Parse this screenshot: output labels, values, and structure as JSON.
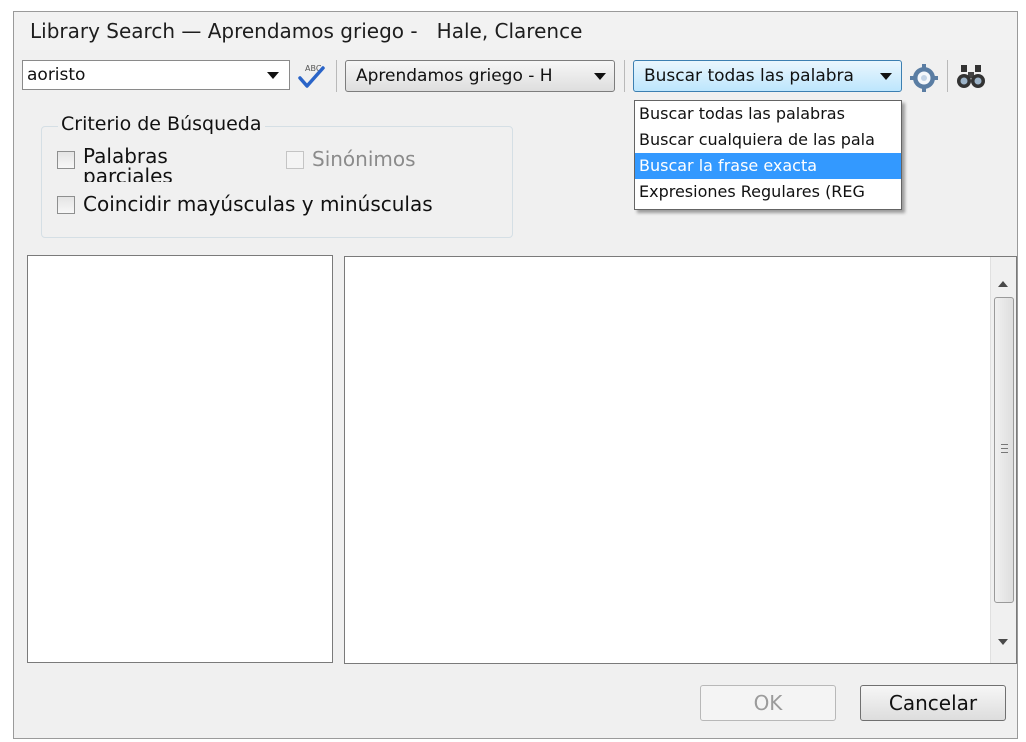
{
  "window": {
    "title": "Library Search — Aprendamos griego -   Hale, Clarence"
  },
  "toolbar": {
    "search_value": "aoristo",
    "spellcheck_icon": "spellcheck-abc-icon",
    "resource_combo_label": "Aprendamos griego -  H",
    "search_mode_label": "Buscar todas las palabra",
    "gear_icon": "gear-icon",
    "search_icon": "binoculars-icon"
  },
  "search_mode_dropdown": {
    "options": [
      "Buscar todas las palabras",
      "Buscar cualquiera de las pala",
      "Buscar la frase exacta",
      "Expresiones Regulares (REG"
    ],
    "highlighted_index": 2
  },
  "criteria": {
    "title": "Criterio de Búsqueda",
    "partial_words_label": "Palabras parciales",
    "partial_words_checked": false,
    "synonyms_label": "Sinónimos",
    "synonyms_checked": false,
    "synonyms_enabled": false,
    "match_case_label": "Coincidir mayúsculas y minúsculas",
    "match_case_checked": false
  },
  "buttons": {
    "ok_label": "OK",
    "ok_enabled": false,
    "cancel_label": "Cancelar"
  },
  "colors": {
    "selection": "#3399ff",
    "window_bg": "#f0f0f0"
  }
}
